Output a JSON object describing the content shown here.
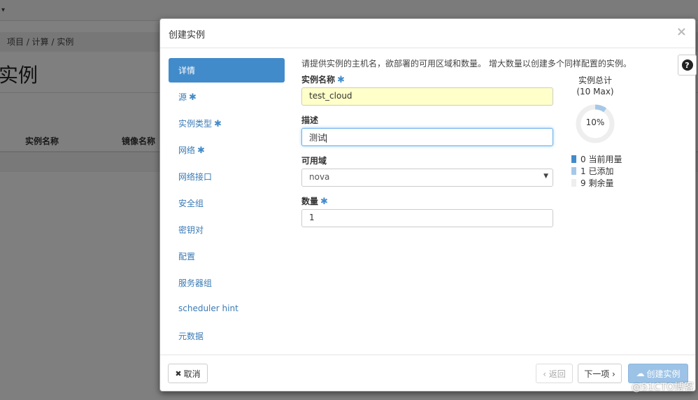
{
  "background": {
    "breadcrumb": "项目 /  计算 /  实例",
    "page_title": "实例",
    "col_name": "实例名称",
    "col_image": "镜像名称"
  },
  "modal": {
    "title": "创建实例",
    "close": "×",
    "help": "?",
    "steps": [
      {
        "label": "详情",
        "required": false
      },
      {
        "label": "源",
        "required": true
      },
      {
        "label": "实例类型",
        "required": true
      },
      {
        "label": "网络",
        "required": true
      },
      {
        "label": "网络接口",
        "required": false
      },
      {
        "label": "安全组",
        "required": false
      },
      {
        "label": "密钥对",
        "required": false
      },
      {
        "label": "配置",
        "required": false
      },
      {
        "label": "服务器组",
        "required": false
      },
      {
        "label": "scheduler hint",
        "required": false
      },
      {
        "label": "元数据",
        "required": false
      }
    ],
    "required_mark": "✱",
    "intro": "请提供实例的主机名，欲部署的可用区域和数量。 增大数量以创建多个同样配置的实例。",
    "fields": {
      "name_label": "实例名称",
      "name_value": "test_cloud",
      "desc_label": "描述",
      "desc_value": "测试",
      "zone_label": "可用域",
      "zone_value": "nova",
      "count_label": "数量",
      "count_value": "1"
    },
    "quota": {
      "title": "实例总计",
      "max": "(10 Max)",
      "percent_label": "10%",
      "percent": 0.1,
      "legend": [
        {
          "text": "0 当前用量",
          "color": "#428bca"
        },
        {
          "text": "1 已添加",
          "color": "#a6c8e8"
        },
        {
          "text": "9 剩余量",
          "color": "#eeeeee"
        }
      ]
    },
    "footer": {
      "cancel": "取消",
      "back": "‹ 返回",
      "next": "下一项 ›",
      "create": "创建实例"
    }
  },
  "watermark": "@51CTO博客",
  "colors": {
    "accent": "#428bca",
    "name_fill": "#ffffc9"
  }
}
